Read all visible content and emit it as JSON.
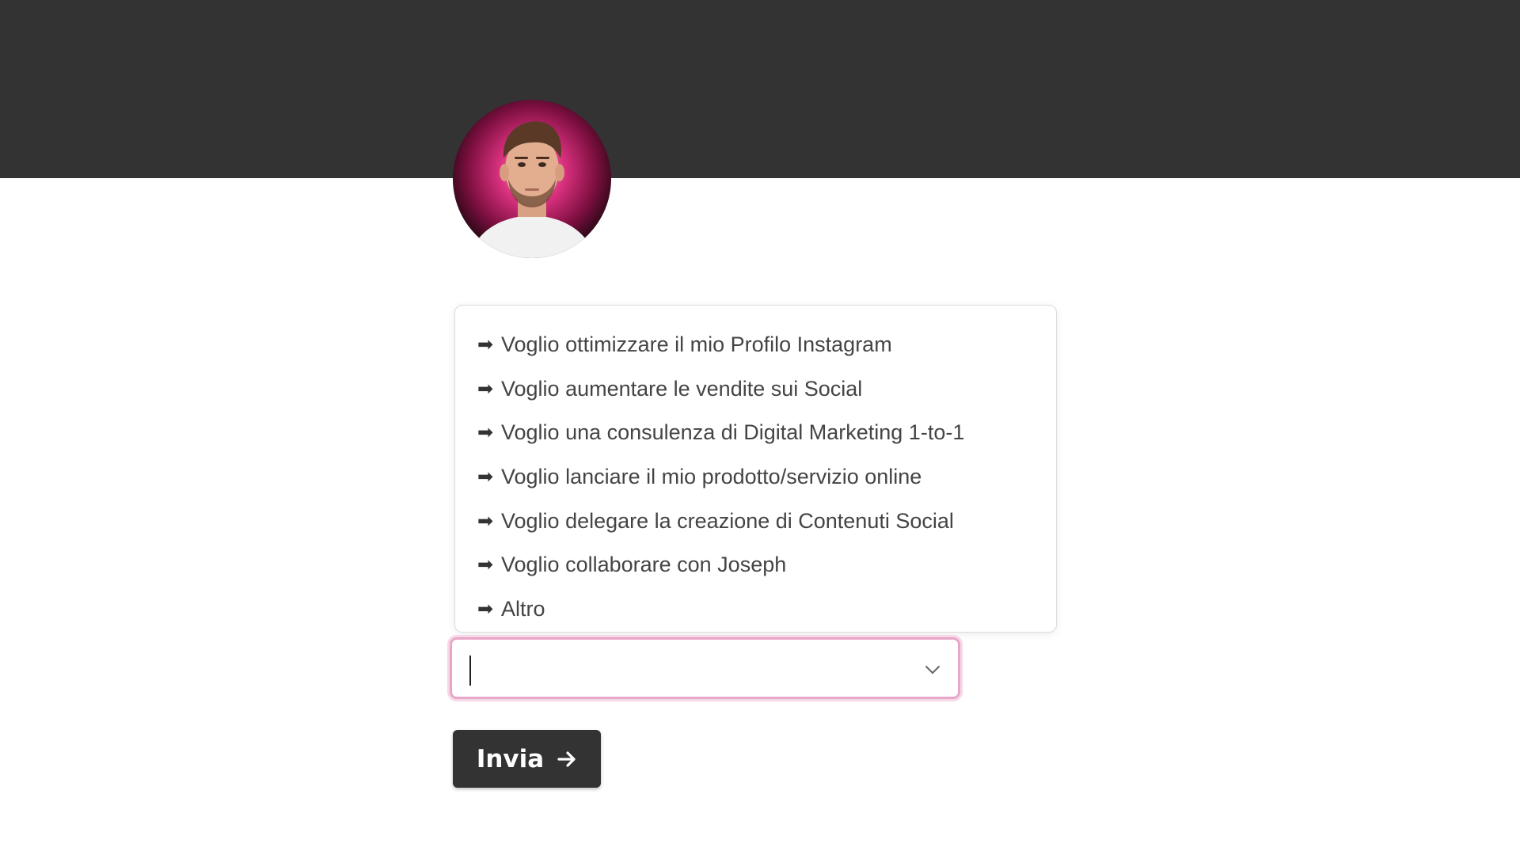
{
  "avatar": {
    "alt": "profile photo"
  },
  "dropdown": {
    "options": [
      {
        "arrow": "➡",
        "label": "Voglio ottimizzare il mio Profilo Instagram"
      },
      {
        "arrow": "➡",
        "label": "Voglio aumentare le vendite sui Social"
      },
      {
        "arrow": "➡",
        "label": "Voglio una consulenza di Digital Marketing 1-to-1"
      },
      {
        "arrow": "➡",
        "label": "Voglio lanciare il mio prodotto/servizio online"
      },
      {
        "arrow": "➡",
        "label": "Voglio delegare la creazione di Contenuti Social"
      },
      {
        "arrow": "➡",
        "label": "Voglio collaborare con Joseph"
      },
      {
        "arrow": "➡",
        "label": "Altro"
      }
    ]
  },
  "select": {
    "value": "",
    "icon": "chevron-down-icon"
  },
  "submit": {
    "label": "Invia",
    "icon": "arrow-right-icon"
  },
  "colors": {
    "header": "#333333",
    "accent_border": "#e8a6c8",
    "button": "#333333",
    "text": "#444444"
  }
}
